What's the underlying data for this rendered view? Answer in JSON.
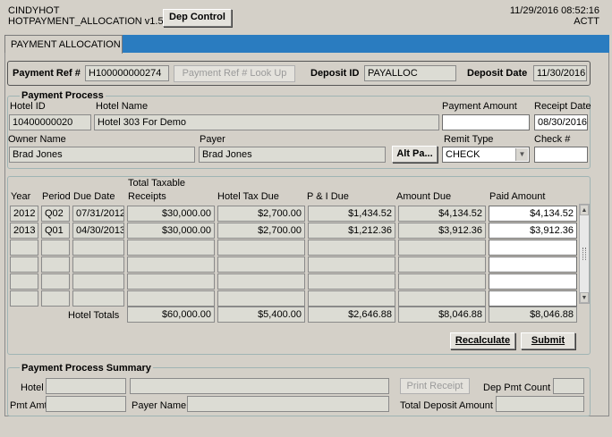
{
  "header": {
    "user": "CINDYHOT",
    "app_title": "HOTPAYMENT_ALLOCATION v1.5",
    "dep_control_label": "Dep Control",
    "datetime": "11/29/2016 08:52:16",
    "env": "ACTT"
  },
  "tab": {
    "label": "PAYMENT ALLOCATION"
  },
  "ref_bar": {
    "payment_ref_label": "Payment Ref #",
    "payment_ref_value": "H100000000274",
    "lookup_label": "Payment Ref # Look Up",
    "deposit_id_label": "Deposit ID",
    "deposit_id_value": "PAYALLOC",
    "deposit_date_label": "Deposit Date",
    "deposit_date_value": "11/30/2016"
  },
  "process": {
    "title": "Payment Process",
    "hotel_id_label": "Hotel ID",
    "hotel_id_value": "10400000020",
    "hotel_name_label": "Hotel Name",
    "hotel_name_value": "Hotel 303 For Demo",
    "payment_amount_label": "Payment Amount",
    "payment_amount_value": "",
    "receipt_date_label": "Receipt Date",
    "receipt_date_value": "08/30/2016",
    "owner_name_label": "Owner Name",
    "owner_name_value": "Brad Jones",
    "payer_label": "Payer",
    "payer_value": "Brad Jones",
    "alt_payer_label": "Alt Pa...",
    "remit_type_label": "Remit Type",
    "remit_type_value": "CHECK",
    "check_no_label": "Check #",
    "check_no_value": ""
  },
  "grid": {
    "headers": {
      "year": "Year",
      "period": "Period",
      "due_date": "Due Date",
      "taxable_line1": "Total Taxable",
      "taxable_line2": "Receipts",
      "hotel_tax": "Hotel Tax Due",
      "pi": "P & I Due",
      "amount_due": "Amount Due",
      "paid": "Paid Amount"
    },
    "rows": [
      [
        "2012",
        "Q02",
        "07/31/2012",
        "$30,000.00",
        "$2,700.00",
        "$1,434.52",
        "$4,134.52",
        "$4,134.52"
      ],
      [
        "2013",
        "Q01",
        "04/30/2013",
        "$30,000.00",
        "$2,700.00",
        "$1,212.36",
        "$3,912.36",
        "$3,912.36"
      ],
      [
        "",
        "",
        "",
        "",
        "",
        "",
        "",
        ""
      ],
      [
        "",
        "",
        "",
        "",
        "",
        "",
        "",
        ""
      ],
      [
        "",
        "",
        "",
        "",
        "",
        "",
        "",
        ""
      ],
      [
        "",
        "",
        "",
        "",
        "",
        "",
        "",
        ""
      ]
    ],
    "totals_label": "Hotel Totals",
    "totals": [
      "$60,000.00",
      "$5,400.00",
      "$2,646.88",
      "$8,046.88",
      "$8,046.88"
    ],
    "recalculate_label": "Recalculate",
    "submit_label": "Submit"
  },
  "summary": {
    "title": "Payment Process Summary",
    "hotel_label": "Hotel",
    "print_receipt_label": "Print Receipt",
    "dep_pmt_count_label": "Dep Pmt Count",
    "pmt_amt_label": "Pmt Amt",
    "payer_name_label": "Payer Name",
    "total_deposit_label": "Total Deposit Amount"
  }
}
